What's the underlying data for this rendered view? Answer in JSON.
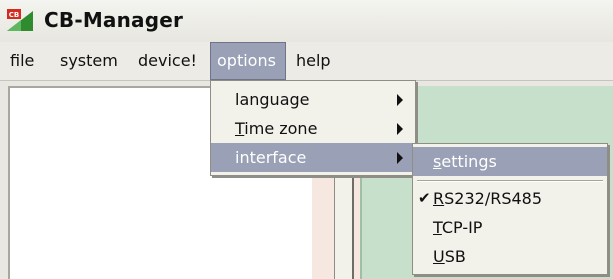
{
  "window": {
    "title": "CB-Manager",
    "icon_name": "cb-app-icon",
    "icon_text": "CB"
  },
  "menubar": {
    "items": [
      {
        "id": "file",
        "label": "file"
      },
      {
        "id": "system",
        "label": "system"
      },
      {
        "id": "device",
        "label": "device!"
      },
      {
        "id": "options",
        "label": "options",
        "active": true
      },
      {
        "id": "help",
        "label": "help"
      }
    ]
  },
  "options_menu": {
    "items": [
      {
        "label": "language",
        "submenu": true,
        "icon": "submenu-arrow-icon"
      },
      {
        "label_prefix": "",
        "mnemonic": "T",
        "label_rest": "ime zone",
        "submenu": true,
        "icon": "submenu-arrow-icon"
      },
      {
        "label": "interface",
        "submenu": true,
        "highlighted": true,
        "icon": "submenu-arrow-icon"
      }
    ]
  },
  "interface_submenu": {
    "items": [
      {
        "mnemonic": "s",
        "label_rest": "ettings",
        "highlighted": true
      },
      {
        "mnemonic": "R",
        "label_rest": "S232/RS485",
        "checked": true,
        "check_glyph": "✔"
      },
      {
        "mnemonic": "T",
        "label_rest": "CP-IP"
      },
      {
        "mnemonic": "U",
        "label_rest": "SB"
      }
    ]
  },
  "colors": {
    "menu_highlight": "#9aa0b5",
    "right_panel": "#c6e0cc",
    "app_icon_green": "#2e8b2e",
    "app_icon_red": "#d42b20"
  }
}
